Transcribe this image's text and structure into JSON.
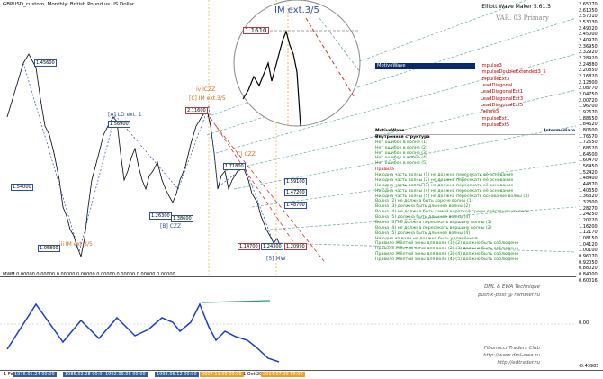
{
  "window": {
    "title": "GBPUSD_custom, Monthly: British Pound vs US Dollar",
    "ewm_version": "Elliott Wave Maker 5.61.5",
    "var_text": "VAR. 03 Primary"
  },
  "price_axis": [
    "2.65070",
    "2.61050",
    "2.57010",
    "2.53030",
    "2.49020",
    "2.45000",
    "2.40970",
    "2.36950",
    "2.32920",
    "2.28920",
    "2.24880",
    "2.20850",
    "2.16820",
    "2.12800",
    "2.08770",
    "2.04750",
    "2.00720",
    "1.96700",
    "1.92670",
    "1.88650",
    "1.84620",
    "1.80600",
    "1.76570",
    "1.72550",
    "1.68520",
    "1.64500",
    "1.60470",
    "1.56450",
    "1.52420",
    "1.48400",
    "1.44370",
    "1.40350",
    "1.36320",
    "1.32300",
    "1.28270",
    "1.24250",
    "1.20220",
    "1.16200",
    "1.12170",
    "1.08150",
    "1.04120",
    "1.00100",
    "0.96070",
    "0.92050",
    "0.88020",
    "0.84000"
  ],
  "indicator_axis": [
    "0.60016",
    "0.00",
    "-0.43985"
  ],
  "indicator_title": "MWM 0.00000 0.00000 0.00000 0.00000 0.00000 0.00000 0.00000 0.00000",
  "time_axis": [
    {
      "text": "1 Feb",
      "style": "plain"
    },
    {
      "text": "1976.05.24 00:00",
      "style": "box"
    },
    {
      "text": "1985.02.28 00:00",
      "style": "box"
    },
    {
      "text": "1992.09.06 00:00",
      "style": "box"
    },
    {
      "text": "1993.06.12 00:00",
      "style": "box"
    },
    {
      "text": "2007.11.09 00:00",
      "style": "orange"
    },
    {
      "text": "1 Oct 20",
      "style": "plain"
    },
    {
      "text": "2014.07.09 19:00",
      "style": "orange"
    }
  ],
  "wave_labels": {
    "iii_ext": "iii IM ext.3/5",
    "iv_cz": "iv ICZZ",
    "c_im": "[C] IM ext.3/5",
    "a_ld": "[A] LD ext. 1",
    "b_cz": "[B] CZZ",
    "czz": "C) CZZ",
    "mw": "[5] MW",
    "zoom_title": "IM ext.3/5",
    "zoom_price": "1.1610"
  },
  "price_boxes": [
    "1.45600",
    "1.54000",
    "1.56900",
    "1.05800",
    "2.11600",
    "1.26300",
    "1.38600",
    "1.71800",
    "1.59100",
    "1.47200",
    "1.14700",
    "1.24300",
    "1.48700",
    "1.20990"
  ],
  "motivewave": {
    "header": "MotiveWave",
    "items": [
      "Impulse3",
      "ImpulseDoubleExtended3_5",
      "ImpulseExt3",
      "LeadDiagonal",
      "LeadDiagonalExt1",
      "LeadDiagonalExt3",
      "LeadDiagonalExt5",
      "Failure5",
      "ImpulseExt1",
      "ImpulseExt5",
      "Intermediate"
    ]
  },
  "rules": {
    "section1_title": "MotiveWave",
    "section2_title": "Внутренняя структура",
    "structure": [
      "Нет ошибок в волне (1)",
      "Нет ошибок в волне (2)",
      "Нет ошибок в волне (3)",
      "Нет ошибок в волне (4)",
      "Нет ошибок в волне (5)"
    ],
    "section3_title": "Правила",
    "rules": [
      "Ни одна часть волны (1) не должна пересекать её основание",
      "Ни одна часть волны (2) не должна пересекать её основание",
      "Ни одна часть волны (3) не должна пересекать её основание",
      "Ни одна часть волны (4) не должна пересекать её основание",
      "Ни одна часть волны (5) не должна пересекать основание волны (3)",
      "Волна (2) не должна быть короче волны (1)",
      "Волна (3) должна быть длиннее волны (2)",
      "Волна (4) не должна быть самой короткой среди действующих волн",
      "Волна (5) должна быть длиннее волны (4)",
      "Волна (3) не должна пересекать вершину волны (1)",
      "Волна (4) не должна пересекать вершину волны (2)",
      "Волна (5) должна быть длиннее волны (4)",
      "Ни одна из волн не должна быть удлинённой",
      "Правило Жёлтой зоны для волн (1)-(2) должно быть соблюдено",
      "Правило Жёлтой зоны для волн (2)-(3) должно быть соблюдено",
      "Правило Жёлтой зоны для волн (3)-(4) должно быть соблюдено",
      "Правило Жёлтой зоны для волн (4)-(5) должно быть соблюдено"
    ]
  },
  "watermarks": {
    "dml": "DML & EWA Technique",
    "dml_email": "putnik-post @ rambler.ru",
    "fib_name": "Fibonacci  Traders  Club",
    "fib_url1": "http://www.dml-ewa.ru",
    "fib_url2": "http://edtrader.ru"
  },
  "colors": {
    "wave_blue": "#2a4ea8",
    "orange": "#d26b1a",
    "mw_header": "#0a2a6e",
    "ok_green": "#1a8a1a",
    "rule_red": "#cc0000"
  }
}
